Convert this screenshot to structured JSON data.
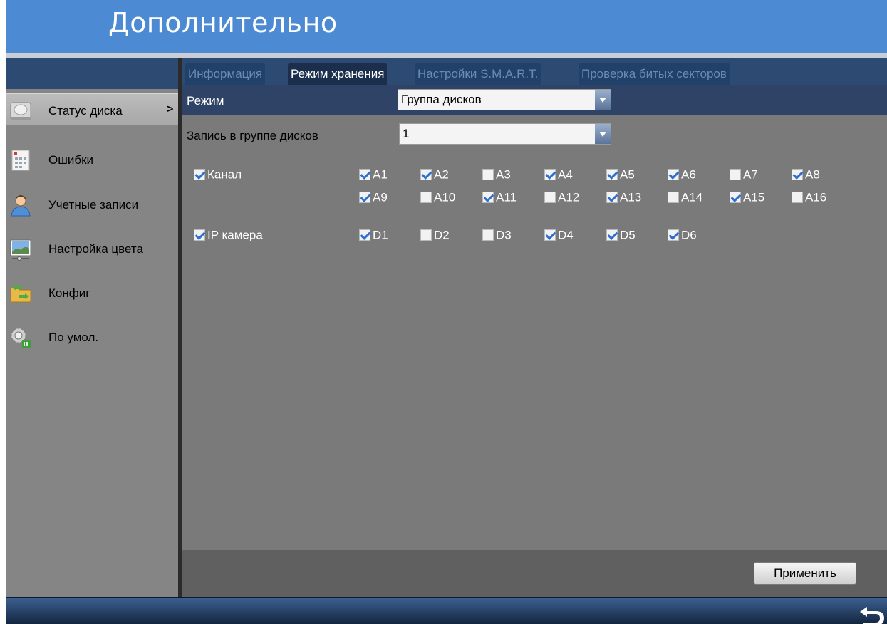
{
  "header": {
    "title": "Дополнительно"
  },
  "sidebar": {
    "items": [
      {
        "label": "Статус диска",
        "icon": "disk-icon",
        "active": true,
        "chevron": ">"
      },
      {
        "label": "Ошибки",
        "icon": "error-list-icon"
      },
      {
        "label": "Учетные записи",
        "icon": "user-icon"
      },
      {
        "label": "Настройка цвета",
        "icon": "color-adjust-icon"
      },
      {
        "label": "Конфиг",
        "icon": "config-folder-icon"
      },
      {
        "label": "По умол.",
        "icon": "gear-reset-icon"
      }
    ]
  },
  "tabs": [
    {
      "label": "Информация",
      "active": false
    },
    {
      "label": "Режим хранения",
      "active": true
    },
    {
      "label": "Настройки S.M.A.R.T.",
      "active": false
    },
    {
      "label": "Проверка битых секторов",
      "active": false
    }
  ],
  "form": {
    "mode_label": "Режим",
    "mode_value": "Группа дисков",
    "group_label": "Запись в группе дисков",
    "group_value": "1",
    "channel_label": "Канал",
    "channel_checked": true,
    "channels": [
      {
        "label": "A1",
        "checked": true
      },
      {
        "label": "A2",
        "checked": true
      },
      {
        "label": "A3",
        "checked": false
      },
      {
        "label": "A4",
        "checked": true
      },
      {
        "label": "A5",
        "checked": true
      },
      {
        "label": "A6",
        "checked": true
      },
      {
        "label": "A7",
        "checked": false
      },
      {
        "label": "A8",
        "checked": true
      },
      {
        "label": "A9",
        "checked": true
      },
      {
        "label": "A10",
        "checked": false
      },
      {
        "label": "A11",
        "checked": true
      },
      {
        "label": "A12",
        "checked": false
      },
      {
        "label": "A13",
        "checked": true
      },
      {
        "label": "A14",
        "checked": false
      },
      {
        "label": "A15",
        "checked": true
      },
      {
        "label": "A16",
        "checked": false
      }
    ],
    "ipcam_label": "IP камера",
    "ipcam_checked": true,
    "ipcams": [
      {
        "label": "D1",
        "checked": true
      },
      {
        "label": "D2",
        "checked": false
      },
      {
        "label": "D3",
        "checked": false
      },
      {
        "label": "D4",
        "checked": true
      },
      {
        "label": "D5",
        "checked": true
      },
      {
        "label": "D6",
        "checked": true
      }
    ]
  },
  "actions": {
    "apply_label": "Применить"
  },
  "colors": {
    "header_blue": "#4d8ad4",
    "nav_dark_blue": "#2d4a72",
    "panel_gray": "#7a7a7a",
    "checkbox_check": "#2c6fd1"
  }
}
